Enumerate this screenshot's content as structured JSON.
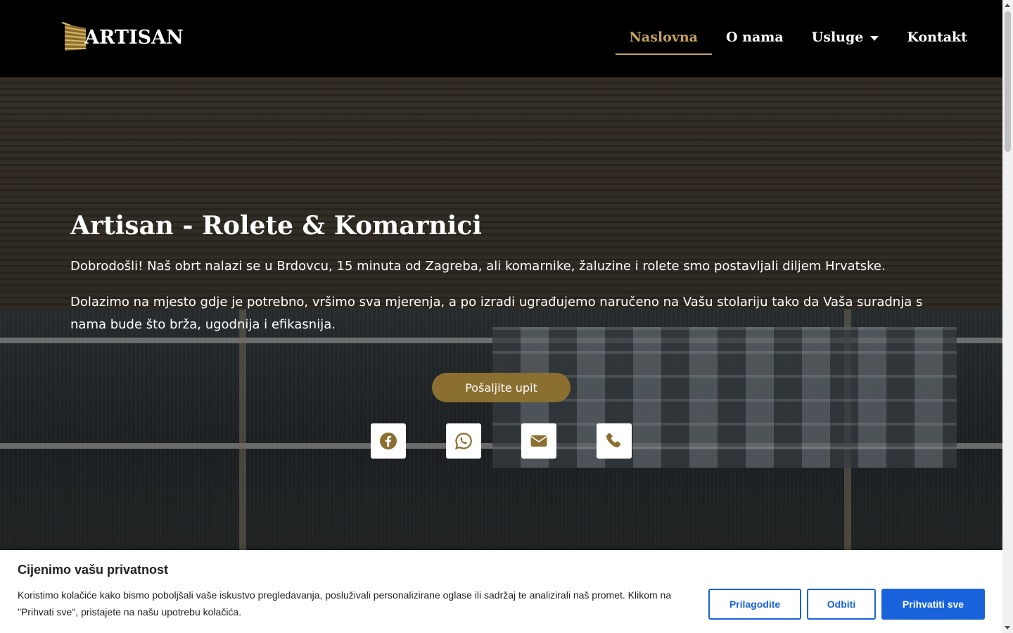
{
  "header": {
    "logo_text": "ARTISAN",
    "nav": [
      {
        "label": "Naslovna",
        "active": true
      },
      {
        "label": "O nama"
      },
      {
        "label": "Usluge",
        "has_dropdown": true
      },
      {
        "label": "Kontakt"
      }
    ],
    "accent_color": "#c7a35a"
  },
  "hero": {
    "title": "Artisan - Rolete & Komarnici",
    "paragraph1": "Dobrodošli! Naš obrt nalazi se u Brdovcu, 15 minuta od Zagreba, ali komarnike, žaluzine i rolete smo postavljali diljem Hrvatske.",
    "paragraph2": "Dolazimo na mjesto gdje je potrebno, vršimo sva mjerenja, a po izradi ugrađujemo naručeno na Vašu stolariju tako da Vaša suradnja s nama bude što brža, ugodnija i efikasnija.",
    "cta_label": "Pošaljite upit",
    "cta_color": "#8a6f30",
    "social_icons": [
      "facebook-icon",
      "whatsapp-icon",
      "envelope-icon",
      "phone-icon"
    ]
  },
  "cookie_banner": {
    "title": "Cijenimo vašu privatnost",
    "text": "Koristimo kolačiće kako bismo poboljšali vaše iskustvo pregledavanja, posluživali personalizirane oglase ili sadržaj te analizirali naš promet. Klikom na \"Prihvati sve\", pristajete na našu upotrebu kolačića.",
    "customize_label": "Prilagodite",
    "reject_label": "Odbiti",
    "accept_label": "Prihvatiti sve",
    "button_color": "#1863dc"
  }
}
